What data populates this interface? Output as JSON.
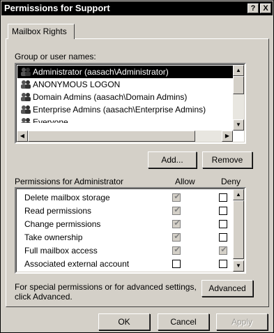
{
  "window": {
    "title": "Permissions for Support",
    "help_button": "?",
    "close_button": "X"
  },
  "tabs": [
    {
      "label": "Mailbox Rights",
      "selected": true
    }
  ],
  "group_section": {
    "label": "Group or user names:",
    "items": [
      {
        "label": "Administrator (aasach\\Administrator)",
        "selected": true
      },
      {
        "label": "ANONYMOUS LOGON",
        "selected": false
      },
      {
        "label": "Domain Admins (aasach\\Domain Admins)",
        "selected": false
      },
      {
        "label": "Enterprise Admins (aasach\\Enterprise Admins)",
        "selected": false
      },
      {
        "label": "Everyone",
        "selected": false
      }
    ],
    "add_button": "Add...",
    "remove_button": "Remove"
  },
  "permissions_section": {
    "label": "Permissions for Administrator",
    "allow_header": "Allow",
    "deny_header": "Deny",
    "rows": [
      {
        "name": "Delete mailbox storage",
        "allow": "checked-disabled",
        "deny": "unchecked"
      },
      {
        "name": "Read permissions",
        "allow": "checked-disabled",
        "deny": "unchecked"
      },
      {
        "name": "Change permissions",
        "allow": "checked-disabled",
        "deny": "unchecked"
      },
      {
        "name": "Take ownership",
        "allow": "checked-disabled",
        "deny": "unchecked"
      },
      {
        "name": "Full mailbox access",
        "allow": "checked-disabled",
        "deny": "checked-disabled"
      },
      {
        "name": "Associated external account",
        "allow": "unchecked",
        "deny": "unchecked"
      }
    ]
  },
  "advanced_section": {
    "text_line1": "For special permissions or for advanced settings,",
    "text_line2": "click Advanced.",
    "advanced_button": "Advanced"
  },
  "footer": {
    "ok_button": "OK",
    "cancel_button": "Cancel",
    "apply_button": "Apply"
  },
  "colors": {
    "dialog_background": "#d4d0c8",
    "title_bar": "#000000",
    "selection": "#000000",
    "disabled_check": "#808080"
  },
  "icons": {
    "user_group": "user-group-icon",
    "scroll_up": "scroll-up-arrow-icon",
    "scroll_down": "scroll-down-arrow-icon",
    "scroll_left": "scroll-left-arrow-icon",
    "scroll_right": "scroll-right-arrow-icon",
    "checkmark": "checkmark-icon"
  }
}
